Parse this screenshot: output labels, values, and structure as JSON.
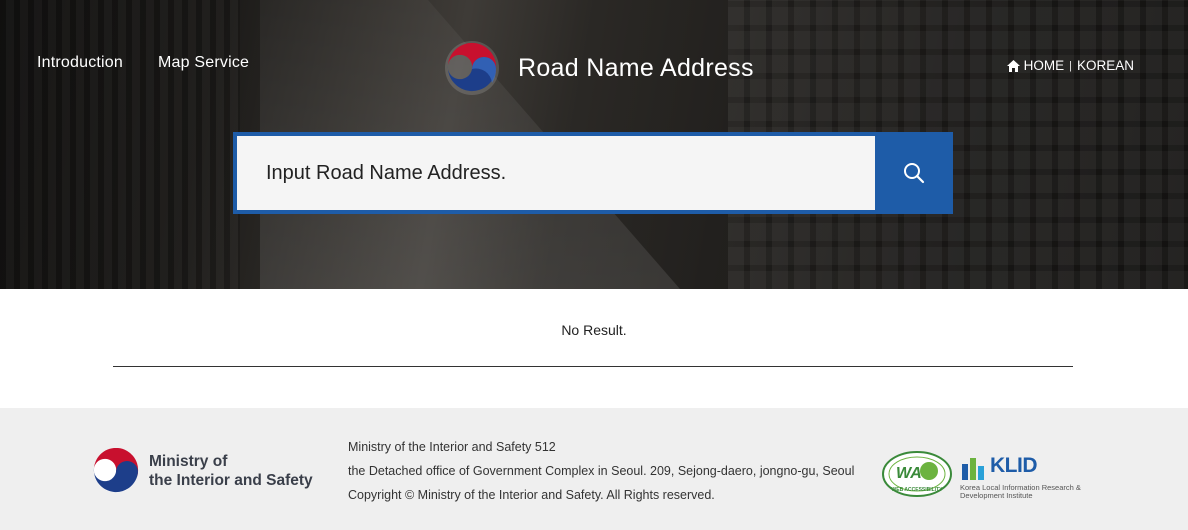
{
  "header": {
    "nav": [
      "Introduction",
      "Map Service"
    ],
    "brand_title": "Road Name Address",
    "home_label": "HOME",
    "separator": "|",
    "language_label": "KOREAN"
  },
  "search": {
    "placeholder": "Input Road Name Address.",
    "button_icon": "search-icon"
  },
  "result": {
    "message": "No Result."
  },
  "footer": {
    "ministry_line1": "Ministry of",
    "ministry_line2": "the Interior and Safety",
    "address_line1": "Ministry of the Interior and Safety 512",
    "address_line2": "the Detached office of Government Complex in Seoul. 209, Sejong-daero, jongno-gu, Seoul",
    "copyright": "Copyright © Ministry of the Interior and Safety. All Rights reserved.",
    "wa_text": "WA",
    "wa_label": "WEB ACCESSIBILITY",
    "klid_name": "KLID",
    "klid_sub_line1": "Korea Local Information Research &",
    "klid_sub_line2": "Development Institute"
  },
  "colors": {
    "accent": "#1e5ca8",
    "taeguk_red": "#c8102e",
    "taeguk_blue": "#1d3e8a",
    "footer_bg": "#efefef"
  }
}
